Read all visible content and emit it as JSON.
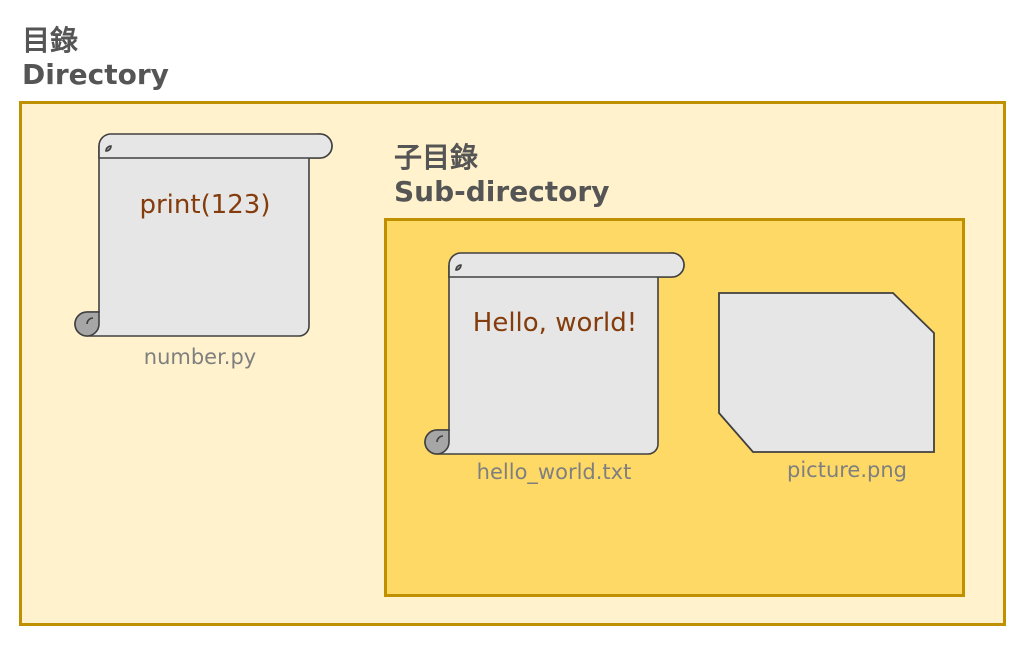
{
  "directory": {
    "label_zh": "目錄",
    "label_en": "Directory",
    "files": [
      {
        "name": "number.py",
        "content": "print(123)"
      }
    ]
  },
  "subdirectory": {
    "label_zh": "子目錄",
    "label_en": "Sub-directory",
    "files": [
      {
        "name": "hello_world.txt",
        "content": "Hello, world!"
      },
      {
        "name": "picture.png"
      }
    ]
  },
  "icons": {
    "text_file": "scroll-icon",
    "image_file": "image-file-icon"
  },
  "colors": {
    "directory_fill": "#fff2cc",
    "subdirectory_fill": "#ffd966",
    "border": "#bf9000",
    "file_fill": "#e6e6e6",
    "content_text": "#843c0c",
    "label_text": "#7f7f7f",
    "heading_text": "#555555"
  }
}
